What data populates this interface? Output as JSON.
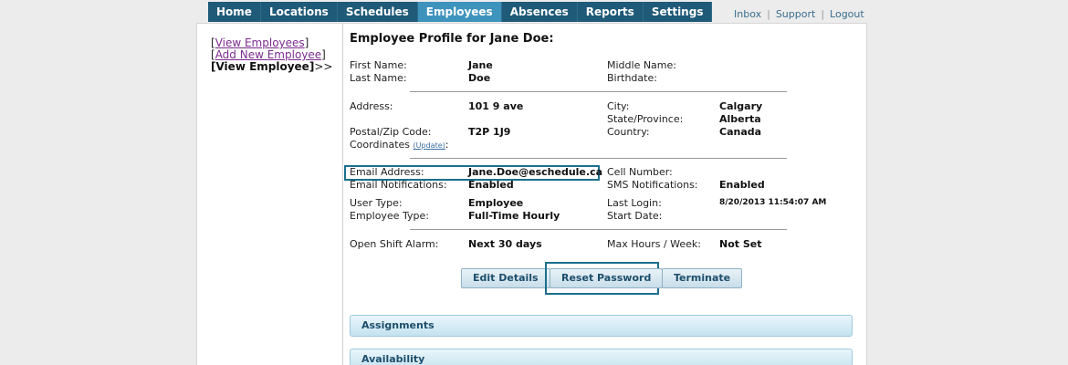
{
  "nav": {
    "items": [
      {
        "label": "Home",
        "active": false
      },
      {
        "label": "Locations",
        "active": false
      },
      {
        "label": "Schedules",
        "active": false
      },
      {
        "label": "Employees",
        "active": true
      },
      {
        "label": "Absences",
        "active": false
      },
      {
        "label": "Reports",
        "active": false
      },
      {
        "label": "Settings",
        "active": false
      }
    ]
  },
  "toplinks": {
    "inbox": "Inbox",
    "support": "Support",
    "logout": "Logout"
  },
  "sidebar": {
    "view_employees": "View Employees",
    "add_new_employee": "Add New Employee",
    "view_employee": "View Employee",
    "arrow": ">>"
  },
  "profile": {
    "title": "Employee Profile for Jane Doe:",
    "first_name_label": "First Name:",
    "first_name": "Jane",
    "last_name_label": "Last Name:",
    "last_name": "Doe",
    "middle_name_label": "Middle Name:",
    "birthdate_label": "Birthdate:",
    "address_label": "Address:",
    "address": "101 9 ave",
    "city_label": "City:",
    "city": "Calgary",
    "state_label": "State/Province:",
    "state": "Alberta",
    "postal_label": "Postal/Zip Code:",
    "postal": "T2P 1J9",
    "country_label": "Country:",
    "country": "Canada",
    "coordinates_label": "Coordinates",
    "coordinates_update": "(Update)",
    "email_label": "Email Address:",
    "email": "Jane.Doe@eschedule.ca",
    "email_notif_label": "Email Notifications:",
    "email_notif": "Enabled",
    "cell_label": "Cell Number:",
    "sms_label": "SMS Notifications:",
    "sms": "Enabled",
    "user_type_label": "User Type:",
    "user_type": "Employee",
    "employee_type_label": "Employee Type:",
    "employee_type": "Full-Time Hourly",
    "last_login_label": "Last Login:",
    "last_login": "8/20/2013 11:54:07 AM",
    "start_date_label": "Start Date:",
    "open_shift_label": "Open Shift Alarm:",
    "open_shift": "Next 30 days",
    "max_hours_label": "Max Hours / Week:",
    "max_hours": "Not Set"
  },
  "buttons": {
    "edit": "Edit Details",
    "reset": "Reset Password",
    "terminate": "Terminate"
  },
  "sections": {
    "assignments": "Assignments",
    "availability": "Availability"
  }
}
